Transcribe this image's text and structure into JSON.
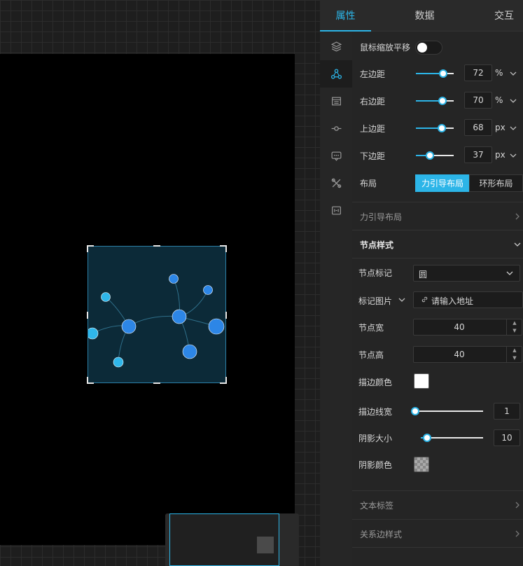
{
  "tabs": [
    {
      "label": "属性",
      "active": true
    },
    {
      "label": "数据",
      "active": false
    },
    {
      "label": "交互",
      "active": false
    }
  ],
  "side_icons": [
    {
      "name": "layers-icon",
      "active": false
    },
    {
      "name": "graph-nodes-icon",
      "active": true
    },
    {
      "name": "table-list-icon",
      "active": false
    },
    {
      "name": "node-line-icon",
      "active": false
    },
    {
      "name": "tooltip-icon",
      "active": false
    },
    {
      "name": "tools-icon",
      "active": false
    },
    {
      "name": "legend-icon",
      "active": false
    }
  ],
  "props": {
    "mouse_zoom_pan": {
      "label": "鼠标缩放平移",
      "enabled": false
    },
    "margins": [
      {
        "label": "左边距",
        "value": "72",
        "unit": "%",
        "level": 72
      },
      {
        "label": "右边距",
        "value": "70",
        "unit": "%",
        "level": 70
      },
      {
        "label": "上边距",
        "value": "68",
        "unit": "px",
        "level": 68
      },
      {
        "label": "下边距",
        "value": "37",
        "unit": "px",
        "level": 37
      }
    ],
    "layout": {
      "label": "布局",
      "options": [
        "力引导布局",
        "环形布局"
      ],
      "selected": "力引导布局"
    },
    "force_layout_section": "力引导布局",
    "node_style": {
      "title": "节点样式",
      "marker": {
        "label": "节点标记",
        "value": "圆"
      },
      "marker_image": {
        "label": "标记图片",
        "placeholder": "请输入地址"
      },
      "node_width": {
        "label": "节点宽",
        "value": "40"
      },
      "node_height": {
        "label": "节点高",
        "value": "40"
      },
      "stroke_color": {
        "label": "描边颜色",
        "color": "#ffffff"
      },
      "stroke_width": {
        "label": "描边线宽",
        "value": "1",
        "level": 0
      },
      "shadow_size": {
        "label": "阴影大小",
        "value": "10",
        "level": 0.1
      },
      "shadow_color": {
        "label": "阴影颜色",
        "color": "transparent"
      }
    },
    "text_label_section": "文本标签",
    "edge_style_section": "关系边样式"
  },
  "colors": {
    "accent": "#2cb5e8",
    "node_primary": "#2d86e6",
    "node_secondary": "#2fb6ea",
    "chart_bg": "#0c2a38"
  }
}
